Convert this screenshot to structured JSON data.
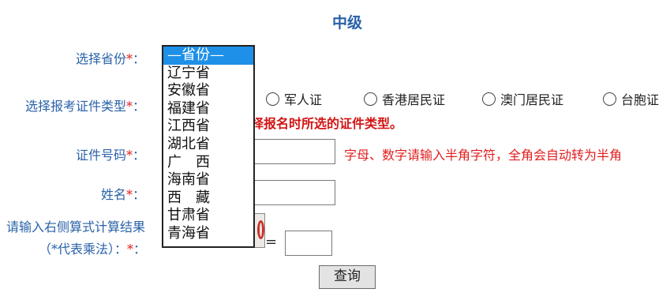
{
  "title": "中级",
  "form": {
    "province_label": "选择省份",
    "id_type_label": "选择报考证件类型",
    "id_number_label": "证件号码",
    "name_label": "姓名",
    "captcha_label_line1": "请输入右侧算式计算结果",
    "captcha_label_line2": "（*代表乘法）：",
    "required_mark": "*",
    "colon": "："
  },
  "id_types": [
    "军人证",
    "香港居民证",
    "澳门居民证",
    "台胞证"
  ],
  "id_type_warning": "择报名时所选的证件类型。",
  "id_number_hint": "字母、数字请输入半角字符，全角会自动转为半角",
  "equals_sign": "=",
  "province_dropdown": {
    "selected": "—省份—",
    "options": [
      "—省份—",
      "辽宁省",
      "安徽省",
      "福建省",
      "江西省",
      "湖北省",
      "广　西",
      "海南省",
      "西　藏",
      "甘肃省",
      "青海省"
    ]
  },
  "query_button": "查询"
}
